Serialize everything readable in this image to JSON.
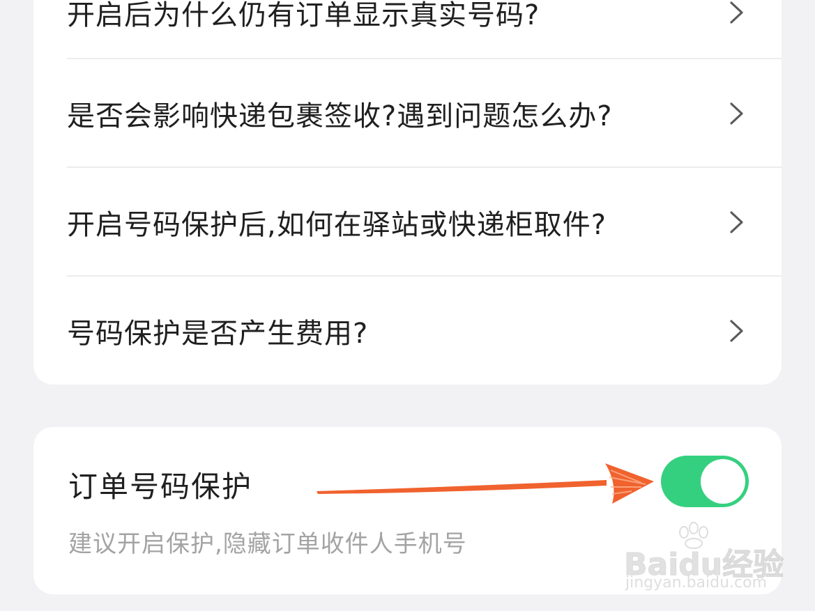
{
  "faq": {
    "items": [
      {
        "question": "开启后为什么仍有订单显示真实号码?"
      },
      {
        "question": "是否会影响快递包裹签收?遇到问题怎么办?"
      },
      {
        "question": "开启号码保护后,如何在驿站或快递柜取件?"
      },
      {
        "question": "号码保护是否产生费用?"
      }
    ],
    "chevron_icon": "chevron-right-icon"
  },
  "protection": {
    "title": "订单号码保护",
    "subtitle": "建议开启保护,隐藏订单收件人手机号",
    "toggle_on": true,
    "toggle_color": "#35d07f"
  },
  "annotation": {
    "arrow_color": "#f0622e",
    "icon": "arrow-right-icon"
  },
  "watermark": {
    "logo": "Baidu经验",
    "url": "jingyan.baidu.com"
  }
}
